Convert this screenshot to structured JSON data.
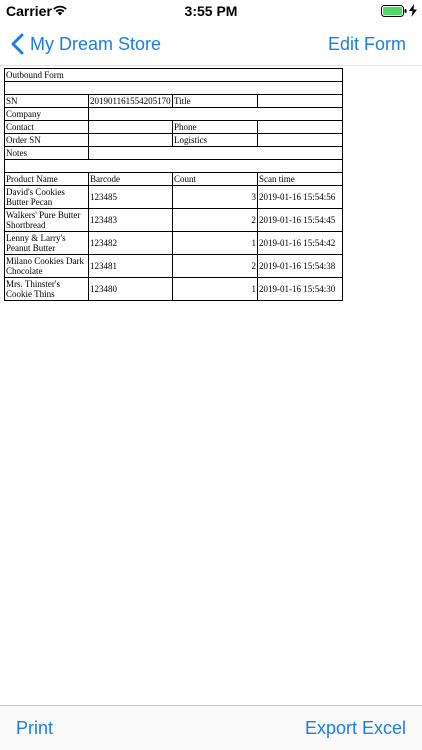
{
  "status_bar": {
    "carrier": "Carrier",
    "time": "3:55 PM"
  },
  "nav": {
    "back_label": "My Dream Store",
    "edit_label": "Edit Form"
  },
  "form": {
    "title": "Outbound Form",
    "sn_label": "SN",
    "sn_value": "201901161554205170",
    "title_label": "Title",
    "title_value": "",
    "company_label": "Company",
    "company_value": "",
    "contact_label": "Contact",
    "contact_value": "",
    "phone_label": "Phone",
    "phone_value": "",
    "order_sn_label": "Order SN",
    "order_sn_value": "",
    "logistics_label": "Logistics",
    "logistics_value": "",
    "notes_label": "Notes",
    "notes_value": "",
    "columns": [
      "Product Name",
      "Barcode",
      "Count",
      "Scan time"
    ],
    "rows": [
      {
        "product": "David's Cookies Butter Pecan",
        "barcode": "123485",
        "count": "3",
        "scan_time": "2019-01-16 15:54:56"
      },
      {
        "product": "Walkers' Pure Butter Shortbread",
        "barcode": "123483",
        "count": "2",
        "scan_time": "2019-01-16 15:54:45"
      },
      {
        "product": "Lenny & Larry's Peanut Butter",
        "barcode": "123482",
        "count": "1",
        "scan_time": "2019-01-16 15:54:42"
      },
      {
        "product": "Milano Cookies Dark Chocolate",
        "barcode": "123481",
        "count": "2",
        "scan_time": "2019-01-16 15:54:38"
      },
      {
        "product": "Mrs. Thinster's Cookie Thins",
        "barcode": "123480",
        "count": "1",
        "scan_time": "2019-01-16 15:54:30"
      }
    ]
  },
  "toolbar": {
    "print_label": "Print",
    "export_label": "Export Excel"
  },
  "colors": {
    "accent": "#1a7ee6",
    "battery": "#4cd964"
  },
  "icons": [
    "wifi-icon",
    "battery-icon",
    "charging-bolt-icon",
    "back-chevron-icon"
  ]
}
